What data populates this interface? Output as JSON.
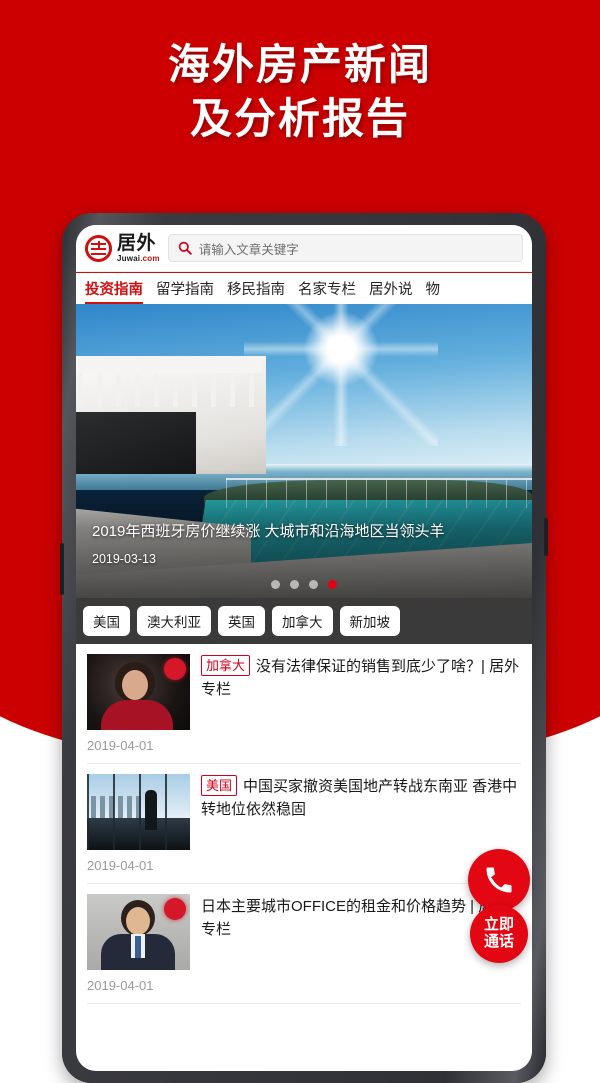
{
  "promo": {
    "line1": "海外房产新闻",
    "line2": "及分析报告",
    "bg_color": "#cc0000"
  },
  "app": {
    "logo": {
      "cn": "居外",
      "en_main": "Juwai",
      "en_dot": ".com",
      "icon": "juwai-circle-logo"
    },
    "search": {
      "placeholder": "请输入文章关键字",
      "value": "",
      "icon": "search-icon"
    },
    "tabs": [
      {
        "label": "投资指南",
        "active": true
      },
      {
        "label": "留学指南",
        "active": false
      },
      {
        "label": "移民指南",
        "active": false
      },
      {
        "label": "名家专栏",
        "active": false
      },
      {
        "label": "居外说",
        "active": false
      },
      {
        "label": "物",
        "active": false
      }
    ],
    "accent_color": "#cf1010"
  },
  "hero": {
    "title": "2019年西班牙房价继续涨 大城市和沿海地区当领头羊",
    "date": "2019-03-13",
    "dots": [
      {
        "active": false
      },
      {
        "active": false
      },
      {
        "active": false
      },
      {
        "active": true
      }
    ],
    "active_dot_color": "#e60012"
  },
  "chips": [
    {
      "label": "美国"
    },
    {
      "label": "澳大利亚"
    },
    {
      "label": "英国"
    },
    {
      "label": "加拿大"
    },
    {
      "label": "新加坡"
    }
  ],
  "articles": [
    {
      "tag": "加拿大",
      "title": "没有法律保证的销售到底少了啥？| 居外专栏",
      "date": "2019-04-01",
      "thumb": "portrait-woman-red-dress"
    },
    {
      "tag": "美国",
      "title": "中国买家撤资美国地产转战东南亚 香港中转地位依然稳固",
      "date": "2019-04-01",
      "thumb": "airport-window-traveler"
    },
    {
      "tag": "",
      "title": "日本主要城市OFFICE的租金和价格趋势 | 居外专栏",
      "date": "2019-04-01",
      "thumb": "portrait-man-suit"
    }
  ],
  "floating": {
    "call_icon": "phone-icon",
    "call_now_line1": "立即",
    "call_now_line2": "通话",
    "color": "#e30613"
  }
}
